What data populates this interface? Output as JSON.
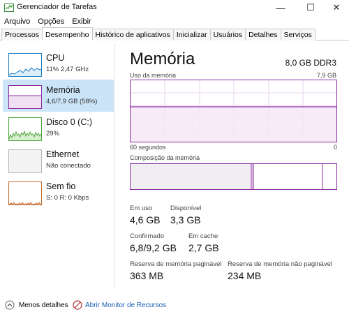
{
  "window": {
    "title": "Gerenciador de Tarefas",
    "minimize_glyph": "—",
    "maximize_glyph": "☐",
    "close_glyph": "✕"
  },
  "menu": {
    "items": [
      {
        "label": "Arquivo"
      },
      {
        "label": "Opções"
      },
      {
        "label": "Exibir"
      }
    ]
  },
  "tabs": [
    {
      "label": "Processos",
      "active": false
    },
    {
      "label": "Desempenho",
      "active": true
    },
    {
      "label": "Histórico de aplicativos",
      "active": false
    },
    {
      "label": "Inicializar",
      "active": false
    },
    {
      "label": "Usuários",
      "active": false
    },
    {
      "label": "Detalhes",
      "active": false
    },
    {
      "label": "Serviços",
      "active": false
    }
  ],
  "sidebar": {
    "items": [
      {
        "name": "CPU",
        "sub": "11% 2,47 GHz",
        "color": "#1a7bbd"
      },
      {
        "name": "Memória",
        "sub": "4,6/7,9 GB (58%)",
        "color": "#8b2ca0"
      },
      {
        "name": "Disco 0 (C:)",
        "sub": "29%",
        "color": "#4da63a"
      },
      {
        "name": "Ethernet",
        "sub": "Não conectado",
        "color": "#a0a0a0"
      },
      {
        "name": "Sem fio",
        "sub": "S: 0 R: 0 Kbps",
        "color": "#c46a2a"
      }
    ]
  },
  "main": {
    "title": "Memória",
    "spec": "8,0 GB DDR3",
    "usage_label": "Uso da memória",
    "usage_max": "7,9 GB",
    "time_label": "60 segundos",
    "time_right": "0",
    "composition_label": "Composição da memória",
    "usage_fraction": 0.58,
    "accent": "#8b2ca0"
  },
  "stats": {
    "em_uso_label": "Em uso",
    "em_uso_value": "4,6 GB",
    "disponivel_label": "Disponível",
    "disponivel_value": "3,3 GB",
    "confirmado_label": "Confirmado",
    "confirmado_value": "6,8/9,2 GB",
    "em_cache_label": "Em cache",
    "em_cache_value": "2,7 GB",
    "paginavel_label": "Reserva de memória paginável",
    "paginavel_value": "363 MB",
    "nao_paginavel_label": "Reserva de memória não paginável",
    "nao_paginavel_value": "234 MB"
  },
  "footer": {
    "less_details": "Menos detalhes",
    "open_monitor": "Abrir Monitor de Recursos"
  }
}
